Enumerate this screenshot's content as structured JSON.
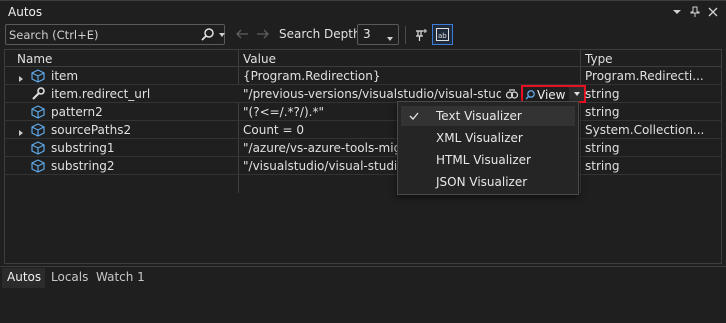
{
  "window": {
    "title": "Autos"
  },
  "title_controls": {
    "dropdown_icon": "chevron-down-icon",
    "pin_icon": "pin-icon",
    "close_icon": "close-icon"
  },
  "toolbar": {
    "search_placeholder": "Search (Ctrl+E)",
    "search_icon": "search-icon",
    "back_icon": "arrow-left-icon",
    "forward_icon": "arrow-right-icon",
    "depth_label": "Search Depth:",
    "depth_value": "3",
    "pin_icon": "pin-icon",
    "hex_icon": "hexadecimal-display-icon"
  },
  "grid": {
    "columns": [
      "Name",
      "Value",
      "Type"
    ],
    "rows": [
      {
        "name": "item",
        "value": "{Program.Redirection}",
        "type": "Program.Redirecti...",
        "expandable": true,
        "icon": "object-icon"
      },
      {
        "name": "item.redirect_url",
        "value": "\"/previous-versions/visualstudio/visual-studio...",
        "type": "string",
        "expandable": false,
        "icon": "wrench-icon"
      },
      {
        "name": "pattern2",
        "value": "\"(?<=/.*?/).*\"",
        "type": "string",
        "expandable": false,
        "icon": "object-icon"
      },
      {
        "name": "sourcePaths2",
        "value": "Count = 0",
        "type": "System.Collection...",
        "expandable": true,
        "icon": "object-icon"
      },
      {
        "name": "substring1",
        "value": "\"/azure/vs-azure-tools-migra",
        "type": "string",
        "expandable": false,
        "icon": "object-icon"
      },
      {
        "name": "substring2",
        "value": "\"/visualstudio/visual-studio-2",
        "type": "string",
        "expandable": false,
        "icon": "object-icon"
      }
    ],
    "visualizer_button": {
      "label": "View",
      "icon": "magnifier-icon",
      "extra_icon": "visualizer-icon"
    }
  },
  "visualizer_menu": {
    "items": [
      {
        "label": "Text Visualizer",
        "checked": true
      },
      {
        "label": "XML Visualizer",
        "checked": false
      },
      {
        "label": "HTML Visualizer",
        "checked": false
      },
      {
        "label": "JSON Visualizer",
        "checked": false
      }
    ]
  },
  "tabs": [
    {
      "label": "Autos",
      "active": true
    },
    {
      "label": "Locals",
      "active": false
    },
    {
      "label": "Watch 1",
      "active": false
    }
  ],
  "colors": {
    "background": "#1f1f1f",
    "highlight": "#e81123",
    "accent": "#3c7ddc",
    "object_icon": "#5fa8e8"
  }
}
